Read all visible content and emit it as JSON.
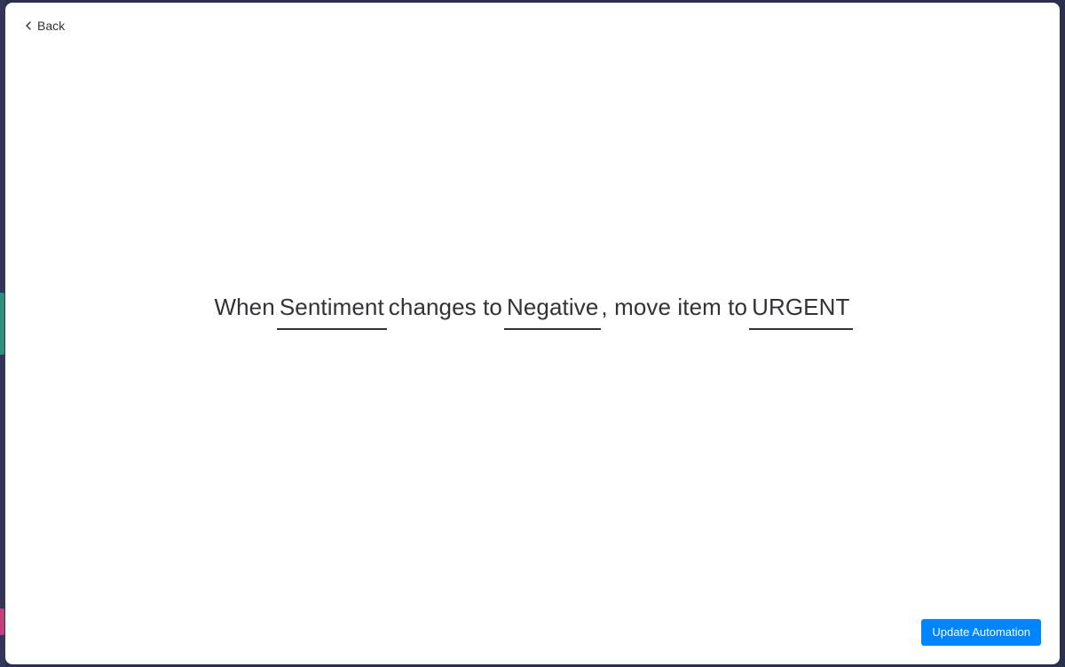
{
  "header": {
    "back_label": "Back"
  },
  "recipe": {
    "word_when": "When",
    "field_column": "Sentiment",
    "word_changes_to": "changes to",
    "field_value": "Negative",
    "word_move_item_to": ", move item to",
    "field_group": "URGENT"
  },
  "footer": {
    "update_label": "Update Automation"
  },
  "colors": {
    "primary": "#0085ff",
    "text": "#323338",
    "backdrop": "#2c2f4e"
  }
}
